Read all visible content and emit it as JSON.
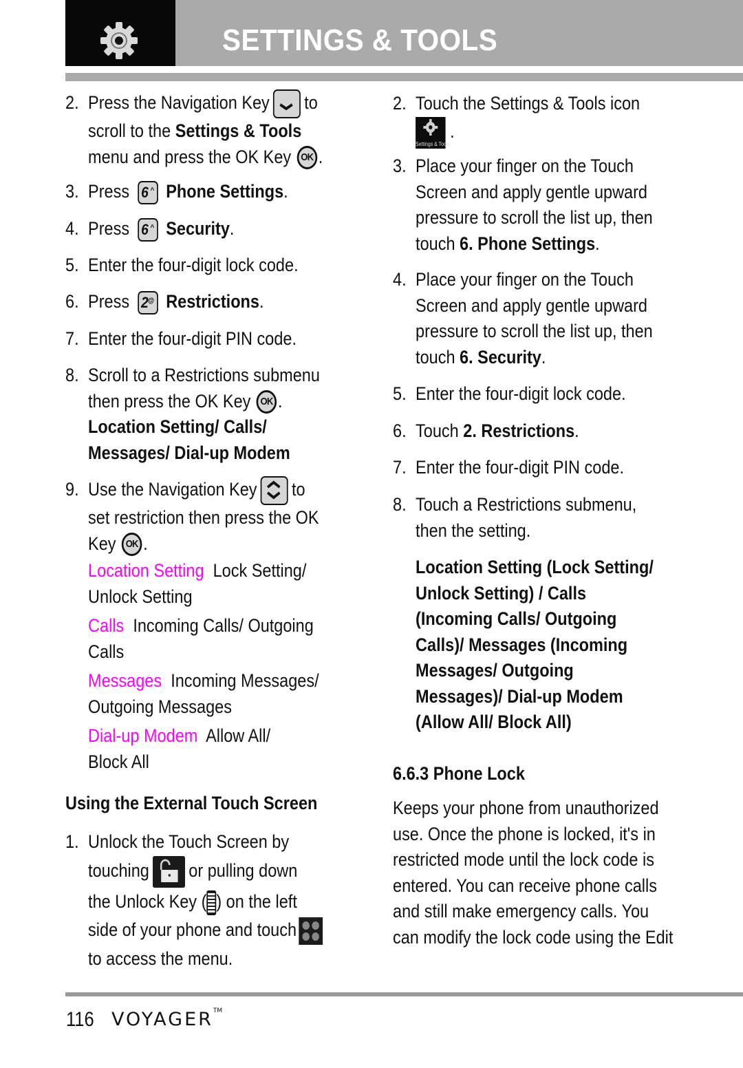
{
  "header": {
    "title": "SETTINGS & TOOLS",
    "icon": "gear-icon"
  },
  "left": {
    "steps": [
      {
        "num": "2.",
        "pre": "Press the Navigation Key",
        "icon": "nav-down-key-icon",
        "post": "to",
        "line2_pre": "scroll to the ",
        "line2_bold": "Settings & Tools",
        "line3": "menu and press the OK Key",
        "ok": "OK",
        "line3_end": "."
      },
      {
        "num": "3.",
        "pre": "Press",
        "key": "6",
        "key_sup": "^",
        "bold": "Phone Settings",
        "end": "."
      },
      {
        "num": "4.",
        "pre": "Press",
        "key": "6",
        "key_sup": "^",
        "bold": "Security",
        "end": "."
      },
      {
        "num": "5.",
        "text": "Enter the four-digit lock code."
      },
      {
        "num": "6.",
        "pre": "Press",
        "key": "2",
        "key_sup": "@",
        "bold": "Restrictions",
        "end": "."
      },
      {
        "num": "7.",
        "text": "Enter the four-digit PIN code."
      },
      {
        "num": "8.",
        "line1": "Scroll to a Restrictions submenu",
        "line2": "then press the OK Key",
        "ok": "OK",
        "line2_end": ".",
        "bold1": "Location Setting/ Calls/",
        "bold2": "Messages/ Dial-up Modem"
      },
      {
        "num": "9.",
        "pre": "Use the Navigation Key",
        "icon": "nav-updown-key-icon",
        "post": "to",
        "line2": "set restriction then press the OK",
        "line3": "Key",
        "ok": "OK",
        "line3_end": "."
      }
    ],
    "options": [
      {
        "label": "Location Setting",
        "value1": "Lock Setting/",
        "value2": "Unlock Setting"
      },
      {
        "label": "Calls",
        "value1": "Incoming Calls/ Outgoing",
        "value2": "Calls"
      },
      {
        "label": "Messages",
        "value1": "Incoming Messages/",
        "value2": "Outgoing Messages"
      },
      {
        "label": "Dial-up Modem",
        "value1": "Allow All/",
        "value2": "Block All"
      }
    ],
    "subhead": "Using the External Touch Screen",
    "touch_step": {
      "num": "1.",
      "line1": "Unlock the Touch Screen by",
      "line2_pre": "touching",
      "line2_post": "or pulling down",
      "line3_pre": "the Unlock Key (",
      "line3_post": ") on the left",
      "line4": "side of your phone and touch",
      "line5": "to access the menu."
    }
  },
  "right": {
    "steps": [
      {
        "num": "2.",
        "text": "Touch the Settings & Tools icon",
        "icon_label": "Settings & Tools",
        "end": "."
      },
      {
        "num": "3.",
        "l1": "Place your finger on the Touch",
        "l2": "Screen and apply gentle upward",
        "l3": "pressure to scroll the list up, then",
        "l4_pre": "touch ",
        "l4_bold": "6. Phone Settings",
        "l4_end": "."
      },
      {
        "num": "4.",
        "l1": "Place your finger on the Touch",
        "l2": "Screen and apply gentle upward",
        "l3": "pressure to scroll the list up, then",
        "l4_pre": "touch ",
        "l4_bold": "6. Security",
        "l4_end": "."
      },
      {
        "num": "5.",
        "text": "Enter the four-digit lock code."
      },
      {
        "num": "6.",
        "pre": "Touch ",
        "bold": "2. Restrictions",
        "end": "."
      },
      {
        "num": "7.",
        "text": "Enter the four-digit PIN code."
      },
      {
        "num": "8.",
        "l1": "Touch a Restrictions submenu,",
        "l2": "then the setting."
      }
    ],
    "bold_block": [
      "Location Setting (Lock Setting/",
      "Unlock Setting) / Calls",
      "(Incoming Calls/ Outgoing",
      "Calls)/ Messages (Incoming",
      "Messages/ Outgoing",
      "Messages)/ Dial-up Modem",
      "(Allow All/ Block All)"
    ],
    "section_title": "6.6.3 Phone Lock",
    "paragraph": [
      "Keeps your phone from unauthorized",
      "use. Once the phone is locked, it's in",
      "restricted mode until the lock code is",
      "entered. You can receive phone calls",
      "and still make emergency calls. You",
      "can modify the lock code using the Edit"
    ]
  },
  "footer": {
    "page_number": "116",
    "brand": "VOYAGER",
    "trademark": "TM"
  }
}
